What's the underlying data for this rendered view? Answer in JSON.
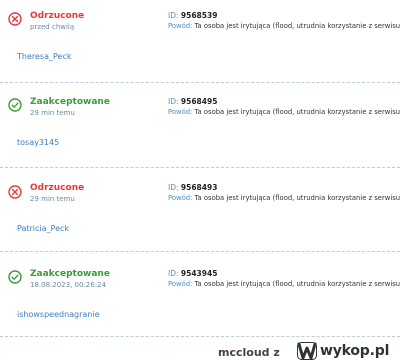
{
  "colors": {
    "rejected": "#e63b3b",
    "accepted": "#3a9c3a",
    "link": "#3b7fc0",
    "separator": "#b9cde0"
  },
  "labels": {
    "id_prefix": "ID:",
    "reason_prefix": "Powód:"
  },
  "reports": [
    {
      "status": "Odrzucone",
      "status_type": "rejected",
      "icon": "x-circle-icon",
      "time": "przed chwilą",
      "id": "9568539",
      "reason": "Ta osoba jest irytująca (flood, utrudnia korzystanie z serwisu)",
      "username": "Theresa_Peck"
    },
    {
      "status": "Zaakceptowane",
      "status_type": "accepted",
      "icon": "check-circle-icon",
      "time": "29 min temu",
      "id": "9568495",
      "reason": "Ta osoba jest irytująca (flood, utrudnia korzystanie z serwisu)",
      "username": "tosay3145"
    },
    {
      "status": "Odrzucone",
      "status_type": "rejected",
      "icon": "x-circle-icon",
      "time": "29 min temu",
      "id": "9568493",
      "reason": "Ta osoba jest irytująca (flood, utrudnia korzystanie z serwisu)",
      "username": "Patricia_Peck"
    },
    {
      "status": "Zaakceptowane",
      "status_type": "accepted",
      "icon": "check-circle-icon",
      "time": "18.08.2023, 00:26:24",
      "id": "9543945",
      "reason": "Ta osoba jest irytująca (flood, utrudnia korzystanie z serwisu)",
      "username": "ishowspeednagranie"
    }
  ],
  "footer": {
    "author": "mccloud",
    "connector": "z",
    "logo_text": "wykop.pl",
    "logo_icon": "wykop-logo-icon"
  }
}
